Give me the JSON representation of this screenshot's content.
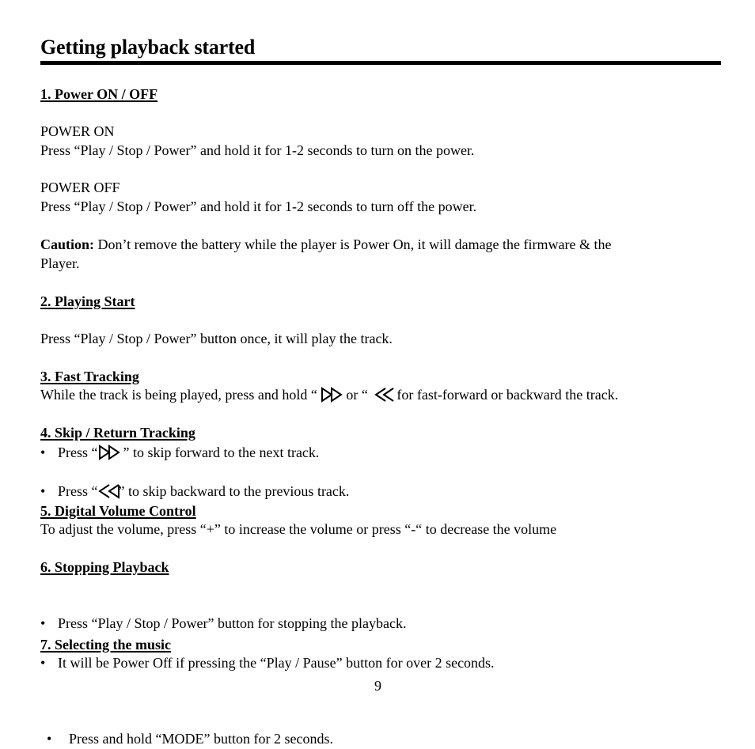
{
  "title": "Getting playback started",
  "sections": {
    "s1": {
      "heading": "1. Power ON / OFF",
      "power_on_label": "POWER ON",
      "power_on_text": "Press “Play / Stop / Power” and hold it for 1-2 seconds to turn on the power.",
      "power_off_label": "POWER OFF",
      "power_off_text": "Press “Play / Stop / Power” and hold it for 1-2 seconds to turn off the power.",
      "caution_label": "Caution:",
      "caution_text_line1": " Don’t remove the battery while the player is Power On, it will damage the firmware & the",
      "caution_text_line2": "Player."
    },
    "s2": {
      "heading": "2.  Playing Start",
      "text": "Press “Play / Stop / Power” button once, it will play the track."
    },
    "s3": {
      "heading": "3. Fast Tracking",
      "text_a": "While the track is being played, press and hold “ ",
      "text_b": "or “ ",
      "text_c": "for fast-forward or backward the track.",
      "icon_forward": "fast-forward-icon",
      "icon_backward": "rewind-icon"
    },
    "s4": {
      "heading": "4. Skip / Return Tracking",
      "items": [
        {
          "pre": "Press “",
          "icon": "skip-forward-icon",
          "post": "” to skip forward to the next track."
        },
        {
          "pre": "Press “",
          "icon": "skip-backward-icon",
          "post": "” to skip backward to the previous track."
        }
      ]
    },
    "s5": {
      "heading": "5. Digital Volume Control",
      "text": "To adjust the volume, press  “+” to increase the volume or press “-“ to decrease the volume"
    },
    "s6": {
      "heading": "6. Stopping Playback",
      "items": [
        "Press “Play / Stop / Power” button for stopping the playback.",
        "It will be Power Off if pressing the “Play / Pause” button for over 2 seconds."
      ]
    },
    "s7": {
      "heading": "7. Selecting the music",
      "items": [
        "Press and hold “MODE” button for 2 seconds."
      ]
    }
  },
  "page_number": "9"
}
